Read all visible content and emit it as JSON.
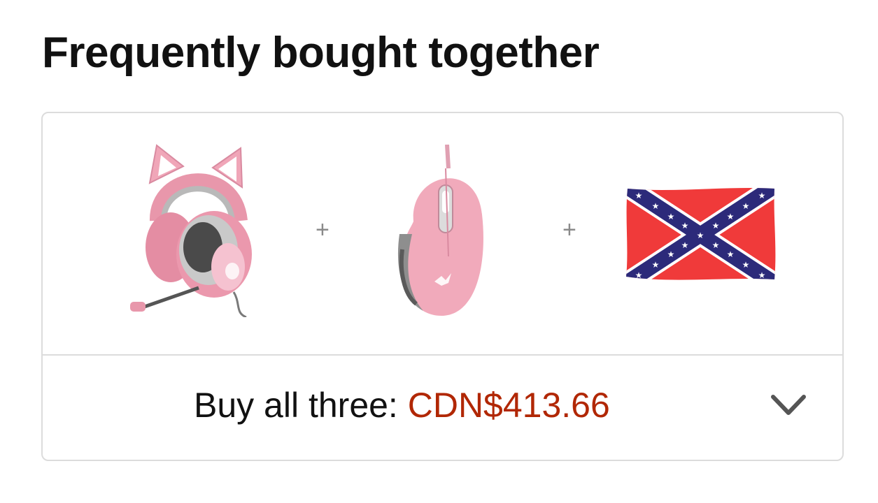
{
  "section": {
    "title": "Frequently bought together"
  },
  "products": [
    {
      "name": "pink cat-ear gaming headset",
      "icon": "headset-icon"
    },
    {
      "name": "pink gaming mouse",
      "icon": "mouse-icon"
    },
    {
      "name": "flag",
      "icon": "flag-icon"
    }
  ],
  "separators": [
    "+",
    "+"
  ],
  "summary": {
    "label": "Buy all three:",
    "price": "CDN$413.66",
    "expand_icon": "chevron-down-icon"
  },
  "colors": {
    "price": "#b12704",
    "border": "#dcdcdc",
    "text": "#111111"
  }
}
